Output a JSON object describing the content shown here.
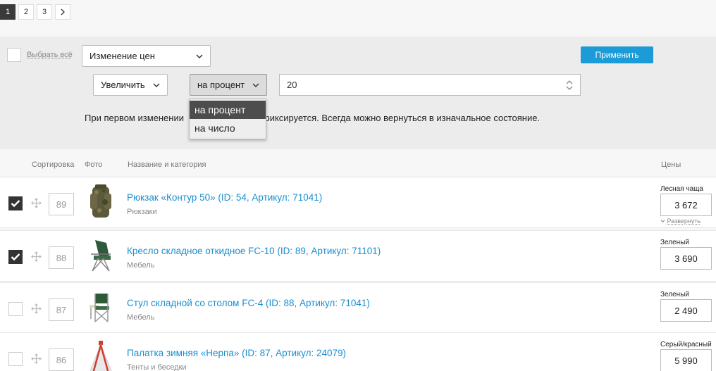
{
  "pagination": {
    "pages": [
      "1",
      "2",
      "3"
    ],
    "next": "›",
    "current": "1"
  },
  "bulk": {
    "select_all_label": "Выбрать всё",
    "action": "Изменение цен",
    "direction": "Увеличить",
    "mode": "на процент",
    "value": "20",
    "apply_label": "Применить",
    "note_start": "При первом изменении",
    "note_end": "фиксируется. Всегда можно вернуться в изначальное состояние.",
    "mode_options": [
      "на процент",
      "на число"
    ]
  },
  "table": {
    "headers": {
      "sort": "Сортировка",
      "photo": "Фото",
      "name": "Название и категория",
      "prices": "Цены"
    },
    "rows": [
      {
        "checked": true,
        "sort": "89",
        "name": "Рюкзак «Контур 50» (ID: 54, Артикул: 71041)",
        "category": "Рюкзаки",
        "variant": "Лесная чаща",
        "price": "3 672",
        "expand": "Развернуть",
        "photo_icon": "backpack"
      },
      {
        "checked": true,
        "sort": "88",
        "name": "Кресло складное откидное FC-10 (ID: 89, Артикул: 71101)",
        "category": "Мебель",
        "variant": "Зеленый",
        "price": "3 690",
        "photo_icon": "folding-chair"
      },
      {
        "checked": false,
        "sort": "87",
        "name": "Стул складной со столом FC-4 (ID: 88, Артикул: 71041)",
        "category": "Мебель",
        "variant": "Зеленый",
        "price": "2 490",
        "photo_icon": "chair-with-table"
      },
      {
        "checked": false,
        "sort": "86",
        "name": "Палатка зимняя «Нерпа» (ID: 87, Артикул: 24079)",
        "category": "Тенты и беседки",
        "variant": "Серый/красный",
        "price": "5 990",
        "photo_icon": "winter-tent"
      }
    ]
  },
  "colors": {
    "accent": "#1b9bd7",
    "link": "#1b8fd0",
    "panel": "#ececec"
  }
}
